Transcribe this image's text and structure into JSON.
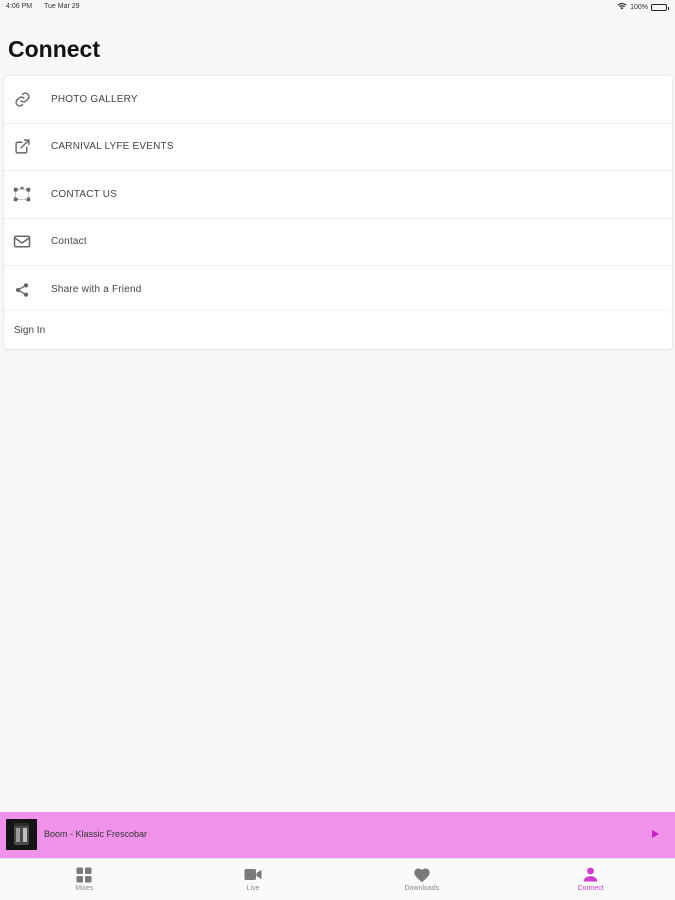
{
  "status_bar": {
    "time": "4:06 PM",
    "date": "Tue Mar 29",
    "battery": "100%",
    "wifi_icon": "wifi-icon",
    "battery_icon": "battery-icon"
  },
  "page": {
    "title": "Connect"
  },
  "menu": {
    "items": [
      {
        "label": "PHOTO GALLERY",
        "icon": "link-icon"
      },
      {
        "label": "CARNIVAL LYFE EVENTS",
        "icon": "external-link-icon"
      },
      {
        "label": "CONTACT US",
        "icon": "network-nodes-icon"
      },
      {
        "label": "Contact",
        "icon": "mail-icon"
      },
      {
        "label": "Share with a Friend",
        "icon": "share-icon"
      }
    ]
  },
  "signin": {
    "label": "Sign In"
  },
  "player": {
    "track": "Boom - Klassic Frescobar",
    "album_art_icon": "album-art",
    "play_icon": "play-icon",
    "background": "#f192ea"
  },
  "tabs": [
    {
      "label": "Mixes",
      "icon": "grid-icon",
      "active": false
    },
    {
      "label": "Live",
      "icon": "video-camera-icon",
      "active": false
    },
    {
      "label": "Downloads",
      "icon": "heart-icon",
      "active": false
    },
    {
      "label": "Connect",
      "icon": "person-icon",
      "active": true
    }
  ],
  "colors": {
    "accent": "#d23ad1",
    "inactive": "#7a7a7a",
    "background": "#f7f7f7"
  }
}
